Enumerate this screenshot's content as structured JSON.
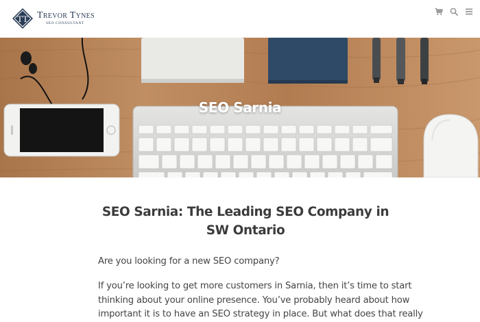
{
  "site": {
    "brand_name": "Trevor Tynes",
    "brand_tagline": "SEO Consultant",
    "logo_text": "TT"
  },
  "header_icons": [
    "cart-icon",
    "search-icon",
    "menu-icon"
  ],
  "hero": {
    "title": "SEO Sarnia"
  },
  "article": {
    "heading": "SEO Sarnia: The Leading SEO Company in SW Ontario",
    "intro": "Are you looking for a new SEO company?",
    "paragraph_lines": [
      "If you’re looking to get more customers in Sarnia, then it’s time to start",
      "thinking about your online presence. You’ve probably heard about how",
      "important it is to have an SEO strategy in place. But what does that really"
    ]
  },
  "colors": {
    "brand_navy": "#2a3d57",
    "text": "#444444",
    "heading": "#3b3b3b",
    "icon_gray": "#9a9a9a"
  }
}
